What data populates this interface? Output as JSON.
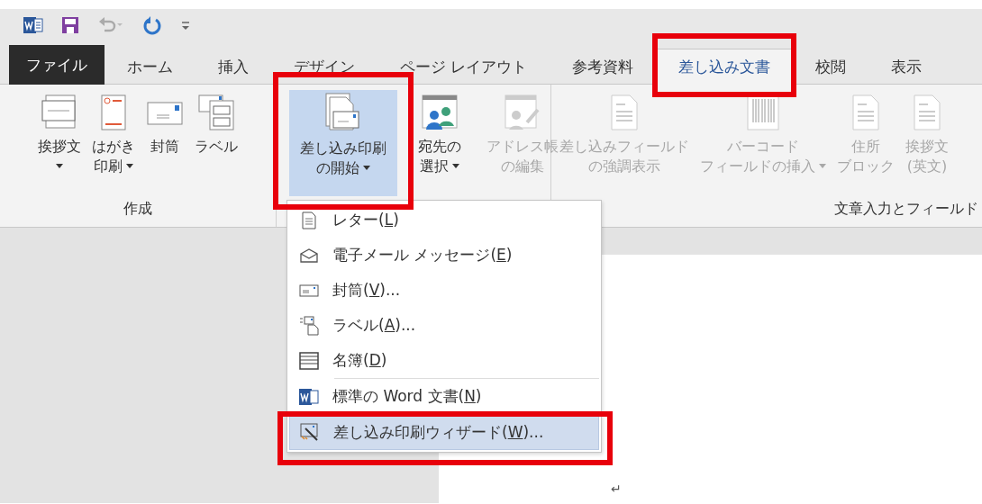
{
  "tabs": [
    {
      "label": "ファイル",
      "kind": "file",
      "selected": false
    },
    {
      "label": "ホーム",
      "kind": "tab",
      "selected": false
    },
    {
      "label": "挿入",
      "kind": "tab",
      "selected": false
    },
    {
      "label": "デザイン",
      "kind": "tab",
      "selected": false
    },
    {
      "label": "ページ レイアウト",
      "kind": "tab",
      "selected": false
    },
    {
      "label": "参考資料",
      "kind": "tab",
      "selected": false
    },
    {
      "label": "差し込み文書",
      "kind": "tab",
      "selected": true
    },
    {
      "label": "校閲",
      "kind": "tab",
      "selected": false
    },
    {
      "label": "表示",
      "kind": "tab",
      "selected": false
    }
  ],
  "ribbon": {
    "groups": [
      {
        "label": "作成",
        "buttons": [
          {
            "lines": [
              "挨拶文"
            ],
            "kind": "greeting",
            "dropdown": true,
            "disabled": false,
            "selected": false
          },
          {
            "lines": [
              "はがき",
              "印刷"
            ],
            "kind": "postcard",
            "dropdown": true,
            "disabled": false,
            "selected": false
          },
          {
            "lines": [
              "封筒"
            ],
            "kind": "envelope",
            "dropdown": false,
            "disabled": false,
            "selected": false
          },
          {
            "lines": [
              "ラベル"
            ],
            "kind": "labels",
            "dropdown": false,
            "disabled": false,
            "selected": false
          }
        ]
      },
      {
        "buttons": [
          {
            "lines": [
              "差し込み印刷",
              "の開始"
            ],
            "kind": "start",
            "dropdown": true,
            "disabled": false,
            "selected": true
          },
          {
            "lines": [
              "宛先の",
              "選択"
            ],
            "kind": "recipients",
            "dropdown": true,
            "disabled": false,
            "selected": false
          },
          {
            "lines": [
              "アドレス帳",
              "の編集"
            ],
            "kind": "editlist",
            "dropdown": false,
            "disabled": true,
            "selected": false
          }
        ]
      },
      {
        "label": "文章入力とフィールド",
        "buttons": [
          {
            "lines": [
              "差し込みフィールド",
              "の強調表示"
            ],
            "kind": "doc",
            "dropdown": false,
            "disabled": true,
            "selected": false
          },
          {
            "lines": [
              "バーコード",
              "フィールドの挿入"
            ],
            "kind": "barcode",
            "dropdown": true,
            "disabled": true,
            "selected": false
          },
          {
            "lines": [
              "住所",
              "ブロック"
            ],
            "kind": "doc",
            "dropdown": false,
            "disabled": true,
            "selected": false
          },
          {
            "lines": [
              "挨拶文",
              "(英文)"
            ],
            "kind": "doc",
            "dropdown": false,
            "disabled": true,
            "selected": false
          }
        ]
      }
    ]
  },
  "menu": {
    "sections": [
      {
        "items": [
          {
            "kind": "letter",
            "before": "レター(",
            "key": "L",
            "after": ")",
            "selected": false
          },
          {
            "kind": "email",
            "before": "電子メール メッセージ(",
            "key": "E",
            "after": ")",
            "selected": false
          },
          {
            "kind": "envelope",
            "before": "封筒(",
            "key": "V",
            "after": ")...",
            "selected": false
          },
          {
            "kind": "labels",
            "before": "ラベル(",
            "key": "A",
            "after": ")...",
            "selected": false
          },
          {
            "kind": "directory",
            "before": "名簿(",
            "key": "D",
            "after": ")",
            "selected": false
          }
        ]
      },
      {
        "items": [
          {
            "kind": "word",
            "before": "標準の Word 文書(",
            "key": "N",
            "after": ")",
            "selected": false
          },
          {
            "kind": "wizard",
            "before": "差し込み印刷ウィザード(",
            "key": "W",
            "after": ")...",
            "selected": true
          }
        ]
      }
    ]
  },
  "document": {
    "paragraph_mark": "↵"
  }
}
